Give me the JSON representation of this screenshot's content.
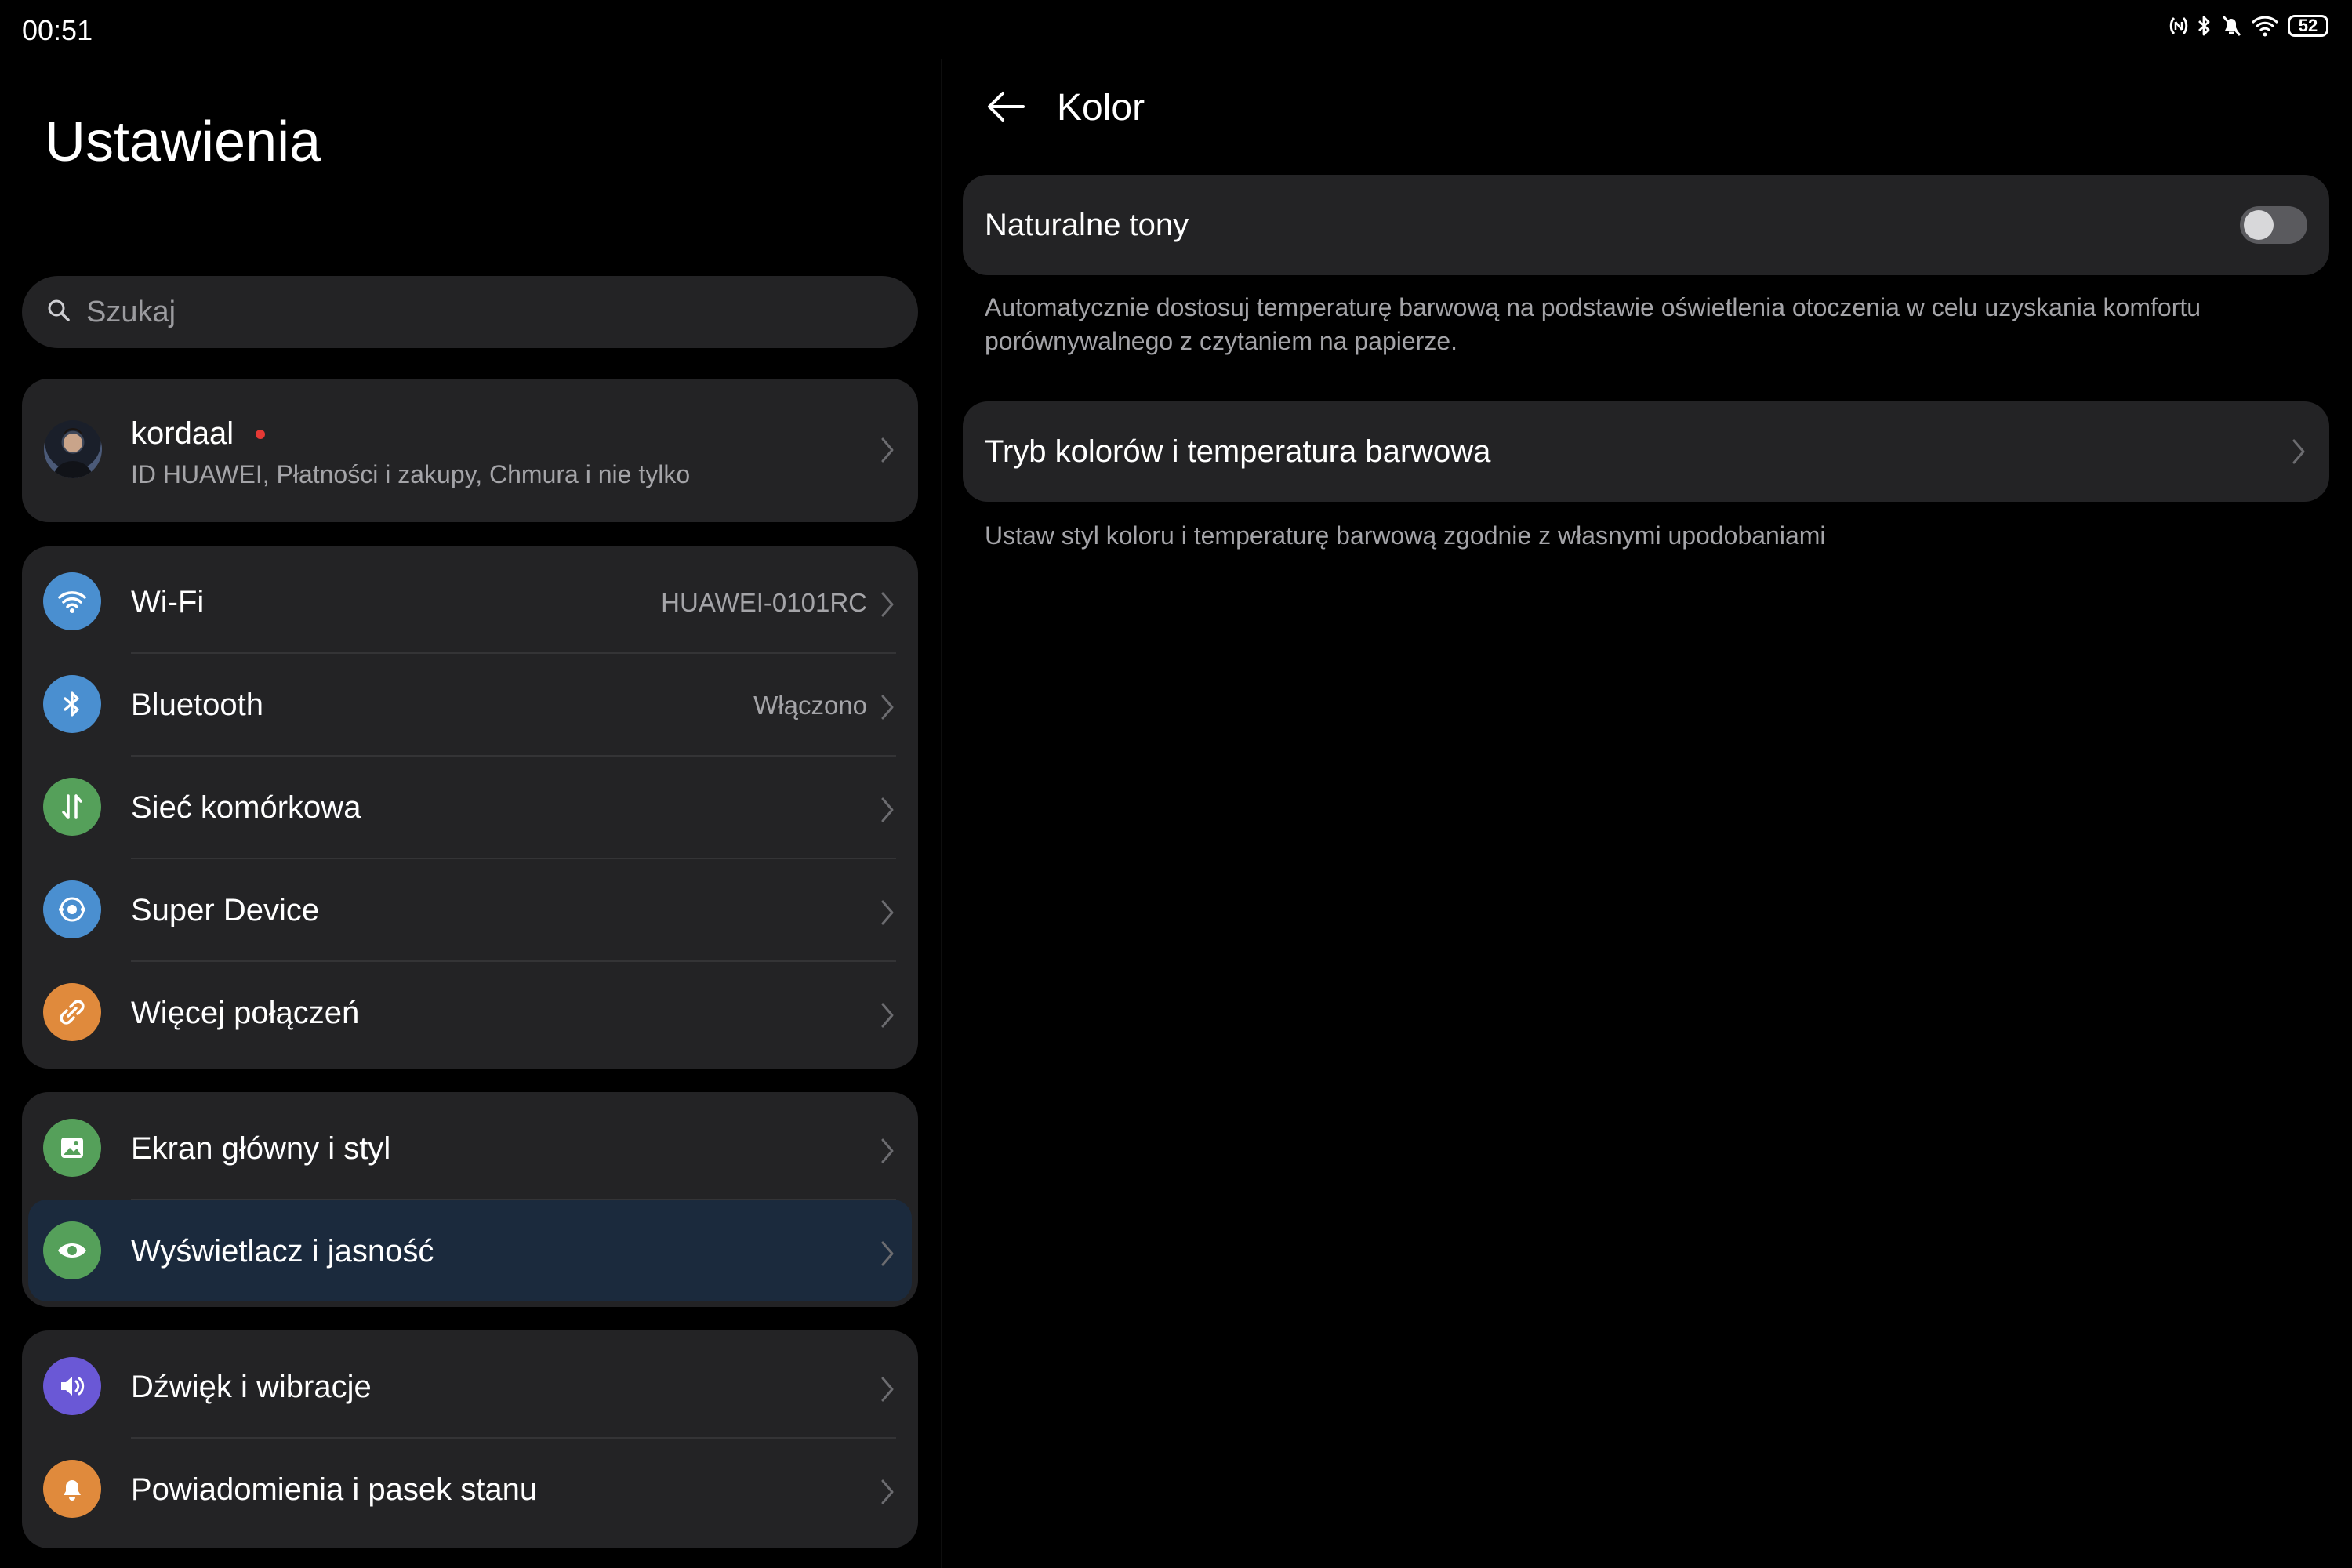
{
  "status_bar": {
    "time": "00:51",
    "battery": "52"
  },
  "sidebar": {
    "title": "Ustawienia",
    "search_placeholder": "Szukaj",
    "account": {
      "name": "kordaal",
      "subtitle": "ID HUAWEI, Płatności i zakupy, Chmura i nie tylko"
    },
    "groups": [
      [
        {
          "label": "Wi-Fi",
          "value": "HUAWEI-0101RC",
          "icon": "wifi-icon",
          "color": "#4a8fd0"
        },
        {
          "label": "Bluetooth",
          "value": "Włączono",
          "icon": "bluetooth-icon",
          "color": "#4a8fd0"
        },
        {
          "label": "Sieć komórkowa",
          "value": "",
          "icon": "mobile-network-icon",
          "color": "#55a05a"
        },
        {
          "label": "Super Device",
          "value": "",
          "icon": "super-device-icon",
          "color": "#4a8fd0"
        },
        {
          "label": "Więcej połączeń",
          "value": "",
          "icon": "link-icon",
          "color": "#e08a3c"
        }
      ],
      [
        {
          "label": "Ekran główny i styl",
          "value": "",
          "icon": "image-icon",
          "color": "#55a05a"
        },
        {
          "label": "Wyświetlacz i jasność",
          "value": "",
          "icon": "eye-icon",
          "color": "#55a05a",
          "selected": true
        }
      ],
      [
        {
          "label": "Dźwięk i wibracje",
          "value": "",
          "icon": "speaker-icon",
          "color": "#6a58d6"
        },
        {
          "label": "Powiadomienia i pasek stanu",
          "value": "",
          "icon": "bell-icon",
          "color": "#e08a3c"
        }
      ]
    ]
  },
  "detail": {
    "title": "Kolor",
    "natural_tones": {
      "label": "Naturalne tony",
      "enabled": false,
      "description_line1": "Automatycznie dostosuj temperaturę barwową na podstawie oświetlenia otoczenia w celu uzyskania komfortu",
      "description_line2": "porównywalnego z czytaniem na papierze."
    },
    "color_mode": {
      "label": "Tryb kolorów i temperatura barwowa",
      "description": "Ustaw styl koloru i temperaturę barwową zgodnie z własnymi upodobaniami"
    }
  }
}
